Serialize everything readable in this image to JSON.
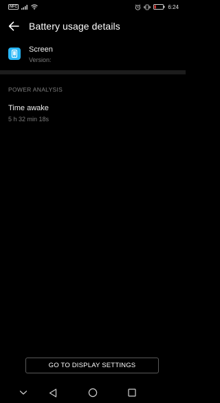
{
  "status_bar": {
    "nfc_label": "NFC",
    "battery_level": "",
    "time": "6:24",
    "battery_color": "#e53935"
  },
  "header": {
    "title": "Battery usage details"
  },
  "app": {
    "name": "Screen",
    "version": "Version:",
    "icon": "phone-screen-icon",
    "icon_color": "#29b6f6"
  },
  "power_analysis": {
    "section_label": "POWER ANALYSIS",
    "time_awake_label": "Time awake",
    "time_awake_value": "5 h 32 min 18s"
  },
  "footer": {
    "button_label": "GO TO DISPLAY SETTINGS"
  },
  "nav": {
    "items": [
      "chevron-down-icon",
      "back-triangle-icon",
      "home-circle-icon",
      "recents-square-icon"
    ]
  }
}
